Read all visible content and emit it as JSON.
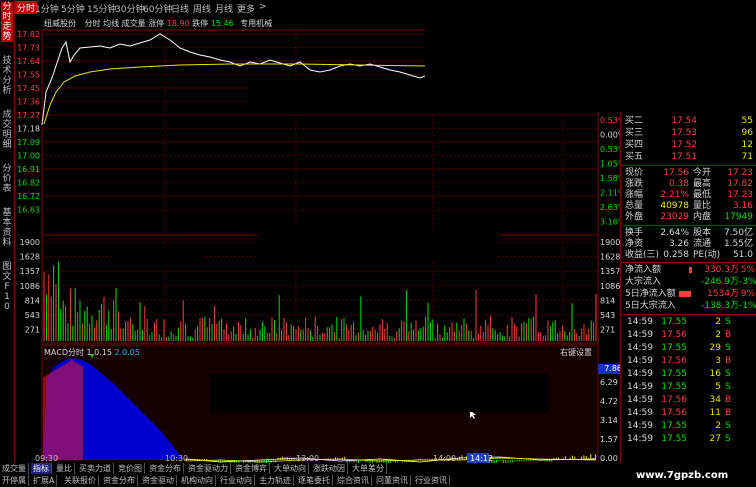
{
  "left_tabs": [
    "分时走势",
    "技术分析",
    "成交明细",
    "分价表",
    "基本资料",
    "图文F10"
  ],
  "period_tabs": [
    "分时",
    "1分钟",
    "5分钟",
    "15分钟",
    "30分钟",
    "60分钟",
    "日线",
    "周线",
    "月线",
    "更多",
    ">"
  ],
  "legend": {
    "name": "纽威股份",
    "mode": "分时",
    "items": [
      "均线",
      "成交量"
    ],
    "change_label": "涨停",
    "change_value": "18.90",
    "limit_down_label": "跌停",
    "limit_down_value": "15.46",
    "board": "专用机械"
  },
  "price_axis_left": [
    "17.82",
    "17.73",
    "17.64",
    "17.55",
    "17.45",
    "17.36",
    "17.27",
    "17.18",
    "17.09",
    "17.00",
    "16.91",
    "16.82",
    "16.72",
    "16.63"
  ],
  "pct_axis_right": [
    "0.53%",
    "0.00%",
    "0.53%",
    "1.05%",
    "1.58%",
    "2.11%",
    "2.63%",
    "3.16%"
  ],
  "volume_axis_left": [
    "1900",
    "1628",
    "1357",
    "1086",
    "814",
    "543",
    "271"
  ],
  "volume_axis_right": [
    "1900",
    "1628",
    "1357",
    "1086",
    "814",
    "543",
    "271"
  ],
  "macd": {
    "label": "MACD分时",
    "dif_label": "1.0.15",
    "dea_label": "2.0.05",
    "settings": "右键设置",
    "right_value_top": "7.86",
    "axis_right": [
      "6.29",
      "4.72",
      "3.14",
      "1.57",
      "0.00"
    ]
  },
  "time_axis": [
    "09:30",
    "10:30",
    "13:00",
    "14:00",
    "14:12"
  ],
  "bottom_tabs_row1": [
    "成交量",
    "指标",
    "量比",
    "买卖力道",
    "竞价图",
    "资金分布",
    "资金驱动力",
    "资金博弈",
    "大单动向",
    "涨跌动因",
    "大单差分"
  ],
  "bottom_tabs_row2": [
    "开停属",
    "扩展A",
    "关联报价",
    "资金分布",
    "资金驱动",
    "机构动向",
    "行业动向",
    "主力轨迹",
    "逐笔委托",
    "综合资讯",
    "问董资讯",
    "行业资讯"
  ],
  "order_book": [
    {
      "label": "买二",
      "price": "17.54",
      "vol": "55"
    },
    {
      "label": "买三",
      "price": "17.53",
      "vol": "96"
    },
    {
      "label": "买四",
      "price": "17.52",
      "vol": "12"
    },
    {
      "label": "买五",
      "price": "17.51",
      "vol": "71"
    }
  ],
  "quote": [
    {
      "l1": "现价",
      "v1": "17.56",
      "l2": "今开",
      "v2": "17.23"
    },
    {
      "l1": "涨跌",
      "v1": "0.38",
      "l2": "最高",
      "v2": "17.82"
    },
    {
      "l1": "涨幅",
      "v1": "2.21%",
      "l2": "最低",
      "v2": "17.23"
    },
    {
      "l1": "总量",
      "v1": "40978",
      "l2": "量比",
      "v2": "3.16"
    },
    {
      "l1": "外盘",
      "v1": "23029",
      "l2": "内盘",
      "v2": "17949"
    }
  ],
  "stats": [
    {
      "l1": "换手",
      "v1": "2.64%",
      "l2": "股本",
      "v2": "7.50亿"
    },
    {
      "l1": "净资",
      "v1": "3.26",
      "l2": "流通",
      "v2": "1.55亿"
    },
    {
      "l1": "收益(三)",
      "v1": "0.258",
      "l2": "PE(动)",
      "v2": "51.0"
    }
  ],
  "flows": [
    {
      "label": "净流入额",
      "value": "330.3万",
      "pct": "5%"
    },
    {
      "label": "大宗流入",
      "value": "-246.9万",
      "pct": "-3%"
    },
    {
      "label": "5日净流入额",
      "value": "1534万",
      "pct": "9%"
    },
    {
      "label": "5日大宗流入",
      "value": "-138.3万",
      "pct": "-1%"
    }
  ],
  "ticks": [
    {
      "t": "14:59",
      "p": "17.55",
      "v": "2",
      "d": "S"
    },
    {
      "t": "14:59",
      "p": "17.56",
      "v": "2",
      "d": "B"
    },
    {
      "t": "14:59",
      "p": "17.55",
      "v": "29",
      "d": "S"
    },
    {
      "t": "14:59",
      "p": "17.56",
      "v": "3",
      "d": "B"
    },
    {
      "t": "14:59",
      "p": "17.55",
      "v": "16",
      "d": "S"
    },
    {
      "t": "14:59",
      "p": "17.55",
      "v": "5",
      "d": "S"
    },
    {
      "t": "14:59",
      "p": "17.56",
      "v": "34",
      "d": "B"
    },
    {
      "t": "14:59",
      "p": "17.56",
      "v": "11",
      "d": "B"
    },
    {
      "t": "14:59",
      "p": "17.55",
      "v": "2",
      "d": "S"
    },
    {
      "t": "14:59",
      "p": "17.55",
      "v": "27",
      "d": "S"
    }
  ],
  "watermark": "www.7gpzb.com",
  "colors": {
    "up": "#ff3c3c",
    "down": "#00e000",
    "grid": "#800000",
    "price_line": "#ffffff",
    "avg_line": "#e8e800",
    "macd_fill": "#0000d0"
  }
}
